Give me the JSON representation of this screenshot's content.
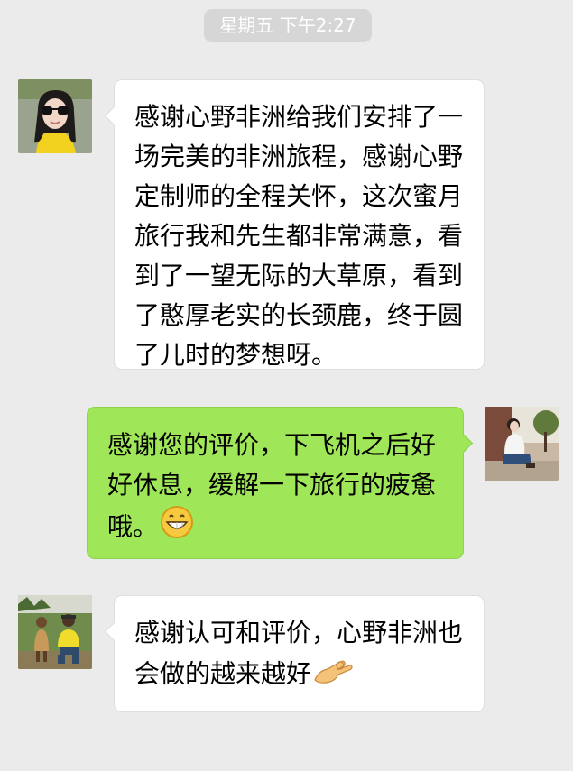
{
  "chat": {
    "timestamp": "星期五 下午2:27",
    "messages": [
      {
        "side": "received",
        "text": "感谢心野非洲给我们安排了一场完美的非洲旅程，感谢心野定制师的全程关怀，这次蜜月旅行我和先生都非常满意，看到了一望无际的大草原，看到了憨厚老实的长颈鹿，终于圆了儿时的梦想呀。",
        "avatar_icon": "woman-in-yellow-avatar"
      },
      {
        "side": "sent",
        "text": "感谢您的评价，下飞机之后好好休息，缓解一下旅行的疲惫哦。",
        "emoji": "grinning-face",
        "avatar_icon": "woman-sitting-outdoors-avatar"
      },
      {
        "side": "received",
        "text": "感谢认可和评价，心野非洲也会做的越来越好",
        "emoji": "ok-hand",
        "avatar_icon": "couple-in-field-avatar"
      }
    ]
  },
  "colors": {
    "background": "#ebebeb",
    "received_bubble": "#ffffff",
    "sent_bubble": "#9fe658",
    "timestamp_pill": "#d6d6d6"
  }
}
